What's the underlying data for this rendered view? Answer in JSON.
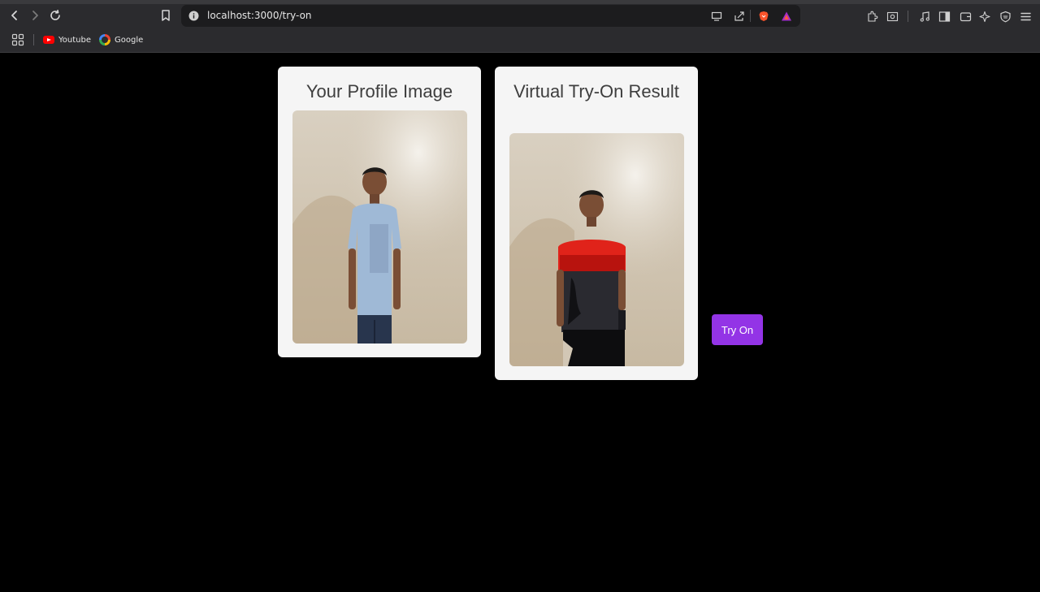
{
  "browser": {
    "url": "localhost:3000/try-on",
    "bookmarks": [
      {
        "label": "Youtube",
        "icon": "youtube-icon"
      },
      {
        "label": "Google",
        "icon": "google-icon"
      }
    ]
  },
  "profile_card": {
    "title": "Your Profile Image",
    "image_description": "person standing against beige wall in light blue t-shirt and dark jeans"
  },
  "result_card": {
    "title": "Virtual Try-On Result",
    "image_description": "person standing against beige wall in red and dark gray t-shirt"
  },
  "try_on_button": {
    "label": "Try On",
    "color": "#9334e6"
  },
  "colors": {
    "page_background": "#000000",
    "card_background": "#f5f5f5",
    "title_color": "#3e3e3e"
  }
}
